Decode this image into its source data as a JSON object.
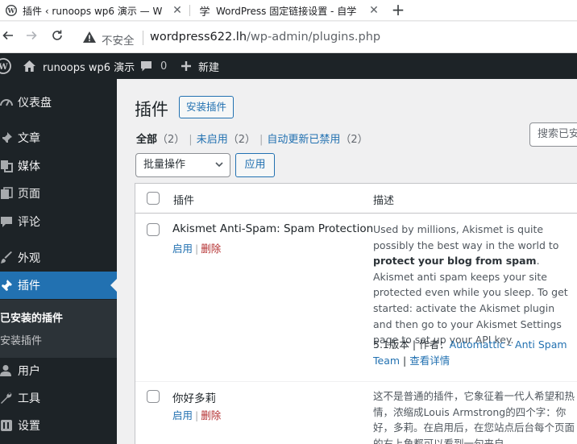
{
  "browser": {
    "tabs": [
      {
        "title": "插件 ‹ runoops wp6 演示 — W",
        "icon": "wordpress-icon"
      },
      {
        "title": "WordPress 固定链接设置 - 自学",
        "icon": "runoob-icon",
        "icon_text": "学"
      }
    ],
    "new_tab": "+",
    "security_label": "不安全",
    "url_host": "wordpress622.lh",
    "url_path": "/wp-admin/plugins.php"
  },
  "admin_bar": {
    "site_name": "runoops wp6 演示",
    "comments_count": "0",
    "new_label": "新建"
  },
  "sidebar": {
    "items": [
      {
        "label": "仪表盘",
        "icon": "dashboard-icon"
      },
      {
        "label": "文章",
        "icon": "pin-icon"
      },
      {
        "label": "媒体",
        "icon": "media-icon"
      },
      {
        "label": "页面",
        "icon": "page-icon"
      },
      {
        "label": "评论",
        "icon": "comment-icon"
      },
      {
        "label": "外观",
        "icon": "brush-icon"
      },
      {
        "label": "插件",
        "icon": "plugin-icon"
      },
      {
        "label": "用户",
        "icon": "user-icon"
      },
      {
        "label": "工具",
        "icon": "wrench-icon"
      },
      {
        "label": "设置",
        "icon": "settings-icon"
      }
    ],
    "submenu": [
      "已安装的插件",
      "安装插件"
    ]
  },
  "main": {
    "title": "插件",
    "add_button": "安装插件",
    "search_placeholder": "搜索已安",
    "filters": [
      {
        "label": "全部",
        "count": "（2）"
      },
      {
        "label": "未启用",
        "count": "（2）"
      },
      {
        "label": "自动更新已禁用",
        "count": "（2）"
      }
    ],
    "filter_sep": "|",
    "bulk_action": "批量操作",
    "apply": "应用",
    "columns": {
      "plugin": "插件",
      "description": "描述"
    },
    "plugins": [
      {
        "name": "Akismet Anti-Spam: Spam Protection",
        "activate": "启用",
        "delete": "删除",
        "desc_1": "Used by millions, Akismet is quite possibly the best way in the world to ",
        "desc_bold": "protect your blog from spam",
        "desc_2": ". Akismet anti spam keeps your site protected even while you sleep. To get started: activate the Akismet plugin and then go to your Akismet Settings page to set up your API key.",
        "version": "5.1版本",
        "author_prefix": "作者：",
        "author": "Automattic - Anti Spam Team",
        "details": "查看详情"
      },
      {
        "name": "你好多莉",
        "activate": "启用",
        "delete": "删除",
        "desc": "这不是普通的插件，它象征着一代人希望和热情，浓缩成Louis Armstrong的四个字：你好，多莉。在启用后，在您站点后台每个页面的右上角都可以看到一句来自"
      }
    ]
  }
}
